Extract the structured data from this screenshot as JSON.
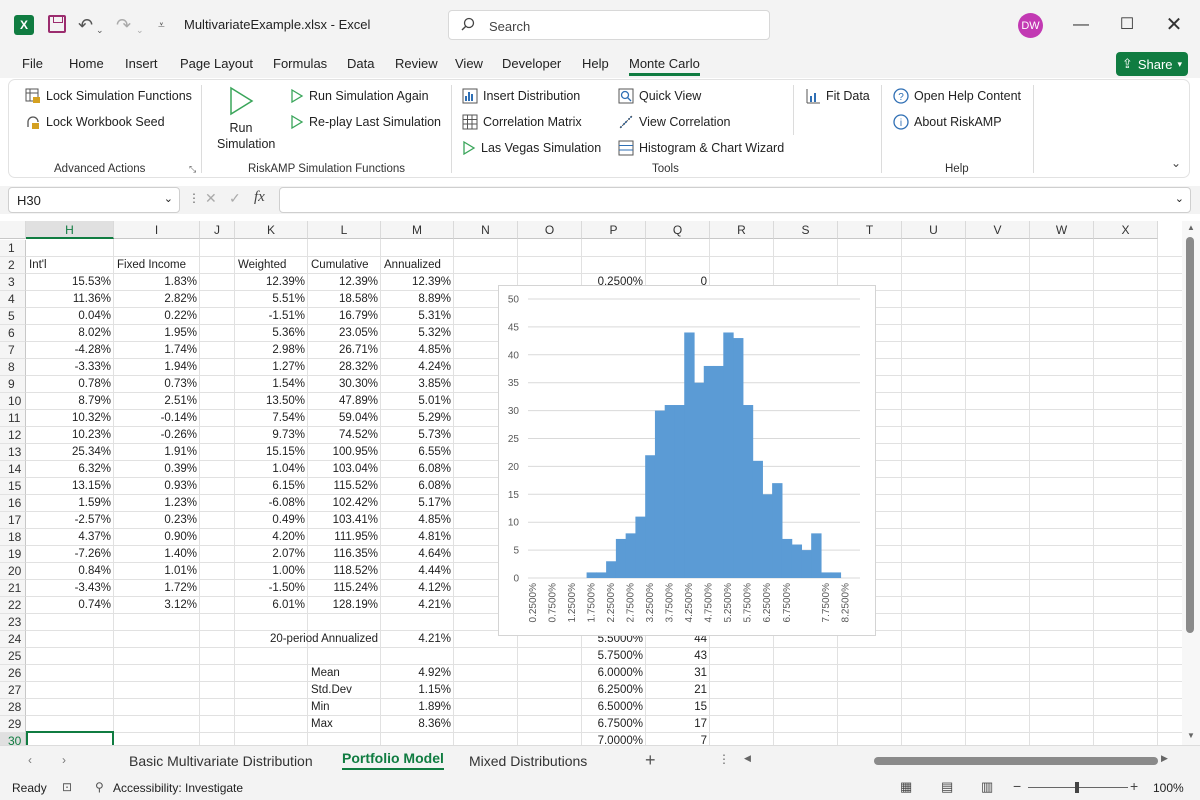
{
  "window": {
    "file_title": "MultivariateExample.xlsx  -  Excel",
    "user_initials": "DW",
    "search_placeholder": "Search"
  },
  "menu": {
    "tabs": [
      "File",
      "Home",
      "Insert",
      "Page Layout",
      "Formulas",
      "Data",
      "Review",
      "View",
      "Developer",
      "Help",
      "Monte Carlo"
    ],
    "active": "Monte Carlo",
    "share": "Share"
  },
  "ribbon": {
    "advanced": {
      "lock_sim": "Lock Simulation Functions",
      "lock_seed": "Lock Workbook Seed",
      "label": "Advanced Actions"
    },
    "riskamp": {
      "run": "Run Simulation",
      "run_again": "Run Simulation Again",
      "replay": "Re-play Last Simulation",
      "label": "RiskAMP Simulation Functions"
    },
    "tools": {
      "insert_dist": "Insert Distribution",
      "corr_matrix": "Correlation Matrix",
      "las_vegas": "Las Vegas Simulation",
      "quick_view": "Quick View",
      "view_corr": "View Correlation",
      "hist_wizard": "Histogram & Chart Wizard",
      "fit_data": "Fit Data",
      "label": "Tools"
    },
    "help": {
      "open_help": "Open Help Content",
      "about": "About RiskAMP",
      "label": "Help"
    }
  },
  "formula_bar": {
    "name_box": "H30",
    "formula": ""
  },
  "columns": [
    "H",
    "I",
    "J",
    "K",
    "L",
    "M",
    "N",
    "O",
    "P",
    "Q",
    "R",
    "S",
    "T",
    "U",
    "V",
    "W",
    "X"
  ],
  "rows": [
    1,
    2,
    3,
    4,
    5,
    6,
    7,
    8,
    9,
    10,
    11,
    12,
    13,
    14,
    15,
    16,
    17,
    18,
    19,
    20,
    21,
    22,
    23,
    24,
    25,
    26,
    27,
    28,
    29,
    30
  ],
  "headers_row2": {
    "H": "Int'l",
    "I": "Fixed Income",
    "K": "Weighted",
    "L": "Cumulative",
    "M": "Annualized"
  },
  "table": [
    [
      "15.53%",
      "1.83%",
      "12.39%",
      "12.39%",
      "12.39%"
    ],
    [
      "11.36%",
      "2.82%",
      "5.51%",
      "18.58%",
      "8.89%"
    ],
    [
      "0.04%",
      "0.22%",
      "-1.51%",
      "16.79%",
      "5.31%"
    ],
    [
      "8.02%",
      "1.95%",
      "5.36%",
      "23.05%",
      "5.32%"
    ],
    [
      "-4.28%",
      "1.74%",
      "2.98%",
      "26.71%",
      "4.85%"
    ],
    [
      "-3.33%",
      "1.94%",
      "1.27%",
      "28.32%",
      "4.24%"
    ],
    [
      "0.78%",
      "0.73%",
      "1.54%",
      "30.30%",
      "3.85%"
    ],
    [
      "8.79%",
      "2.51%",
      "13.50%",
      "47.89%",
      "5.01%"
    ],
    [
      "10.32%",
      "-0.14%",
      "7.54%",
      "59.04%",
      "5.29%"
    ],
    [
      "10.23%",
      "-0.26%",
      "9.73%",
      "74.52%",
      "5.73%"
    ],
    [
      "25.34%",
      "1.91%",
      "15.15%",
      "100.95%",
      "6.55%"
    ],
    [
      "6.32%",
      "0.39%",
      "1.04%",
      "103.04%",
      "6.08%"
    ],
    [
      "13.15%",
      "0.93%",
      "6.15%",
      "115.52%",
      "6.08%"
    ],
    [
      "1.59%",
      "1.23%",
      "-6.08%",
      "102.42%",
      "5.17%"
    ],
    [
      "-2.57%",
      "0.23%",
      "0.49%",
      "103.41%",
      "4.85%"
    ],
    [
      "4.37%",
      "0.90%",
      "4.20%",
      "111.95%",
      "4.81%"
    ],
    [
      "-7.26%",
      "1.40%",
      "2.07%",
      "116.35%",
      "4.64%"
    ],
    [
      "0.84%",
      "1.01%",
      "1.00%",
      "118.52%",
      "4.44%"
    ],
    [
      "-3.43%",
      "1.72%",
      "-1.50%",
      "115.24%",
      "4.12%"
    ],
    [
      "0.74%",
      "3.12%",
      "6.01%",
      "128.19%",
      "4.21%"
    ]
  ],
  "summary": {
    "annualized_label": "20-period Annualized",
    "annualized_value": "4.21%",
    "stats": [
      [
        "Mean",
        "4.92%"
      ],
      [
        "Std.Dev",
        "1.15%"
      ],
      [
        "Min",
        "1.89%"
      ],
      [
        "Max",
        "8.36%"
      ]
    ]
  },
  "pq_visible": {
    "row3": [
      "0.2500%",
      "0"
    ],
    "rows24_30": [
      [
        "5.5000%",
        "44"
      ],
      [
        "5.7500%",
        "43"
      ],
      [
        "6.0000%",
        "31"
      ],
      [
        "6.2500%",
        "21"
      ],
      [
        "6.5000%",
        "15"
      ],
      [
        "6.7500%",
        "17"
      ],
      [
        "7.0000%",
        "7"
      ]
    ]
  },
  "chart_data": {
    "type": "area",
    "x": [
      "0.2500%",
      "0.5000%",
      "0.7500%",
      "1.0000%",
      "1.2500%",
      "1.5000%",
      "1.7500%",
      "2.0000%",
      "2.2500%",
      "2.5000%",
      "2.7500%",
      "3.0000%",
      "3.2500%",
      "3.5000%",
      "3.7500%",
      "4.0000%",
      "4.2500%",
      "4.5000%",
      "4.7500%",
      "5.0000%",
      "5.2500%",
      "5.5000%",
      "5.7500%",
      "6.0000%",
      "6.2500%",
      "6.5000%",
      "6.7500%",
      "7.0000%",
      "7.2500%",
      "7.5000%",
      "7.7500%",
      "8.0000%",
      "8.2500%",
      "8.5000%"
    ],
    "values": [
      0,
      0,
      0,
      0,
      0,
      0,
      1,
      1,
      3,
      7,
      8,
      11,
      22,
      30,
      31,
      31,
      44,
      35,
      38,
      38,
      44,
      43,
      31,
      21,
      15,
      17,
      7,
      6,
      5,
      8,
      1,
      1,
      0,
      0
    ],
    "tick_labels": [
      "0.2500%",
      "0.7500%",
      "1.2500%",
      "1.7500%",
      "2.2500%",
      "2.7500%",
      "3.2500%",
      "3.7500%",
      "4.2500%",
      "4.7500%",
      "5.2500%",
      "5.7500%",
      "6.2500%",
      "6.7500%",
      "7.7500%",
      "8.2500%"
    ],
    "yticks": [
      "0",
      "5",
      "10",
      "15",
      "20",
      "25",
      "30",
      "35",
      "40",
      "45",
      "50"
    ],
    "ylim": [
      0,
      50
    ],
    "color": "#5b9bd5"
  },
  "sheets": {
    "tabs": [
      "Basic Multivariate Distribution",
      "Portfolio Model",
      "Mixed Distributions"
    ],
    "active": "Portfolio Model"
  },
  "status": {
    "ready": "Ready",
    "accessibility": "Accessibility: Investigate",
    "zoom": "100%"
  }
}
